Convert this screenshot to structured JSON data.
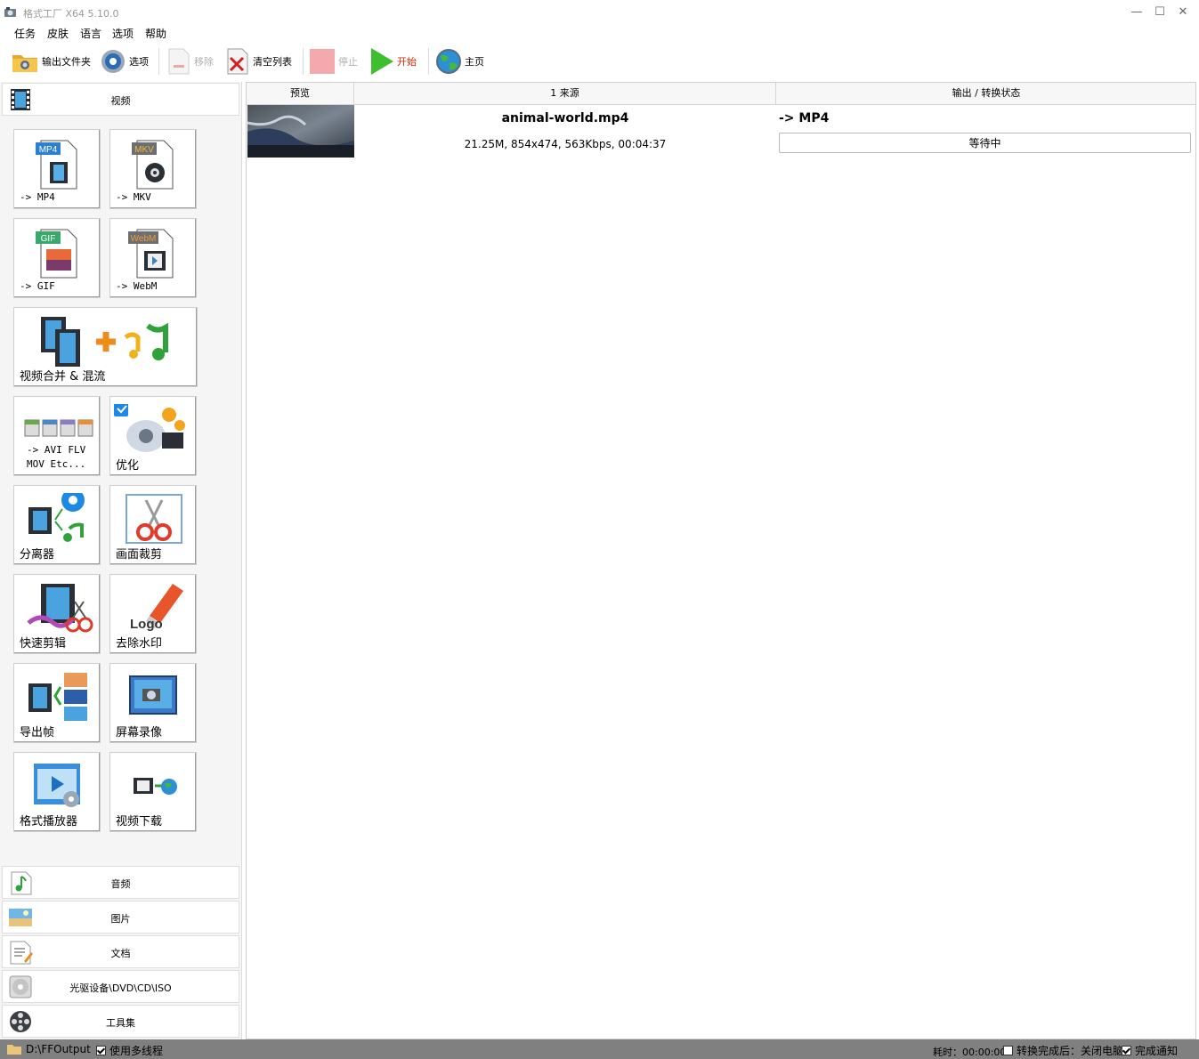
{
  "window": {
    "title": "格式工厂 X64 5.10.0",
    "minimize": "—",
    "maximize": "☐",
    "close": "✕"
  },
  "menu": [
    "任务",
    "皮肤",
    "语言",
    "选项",
    "帮助"
  ],
  "toolbar": {
    "output_folder": "输出文件夹",
    "options": "选项",
    "remove": "移除",
    "clear_list": "清空列表",
    "stop": "停止",
    "start": "开始",
    "home": "主页"
  },
  "sidebar": {
    "video": "视频",
    "audio": "音频",
    "image": "图片",
    "document": "文档",
    "disc": "光驱设备\\DVD\\CD\\ISO",
    "tools": "工具集"
  },
  "tiles": {
    "mp4": "-> MP4",
    "mkv": "-> MKV",
    "gif": "-> GIF",
    "webm": "-> WebM",
    "merge": "视频合并 & 混流",
    "avi": "-> AVI FLV\nMOV Etc...",
    "optimize": "优化",
    "splitter": "分离器",
    "crop": "画面裁剪",
    "quick_edit": "快速剪辑",
    "remove_watermark": "去除水印",
    "export_frames": "导出帧",
    "screen_record": "屏幕录像",
    "player": "格式播放器",
    "download": "视频下载"
  },
  "icon_text": {
    "mp4": "MP4",
    "mkv": "MKV",
    "gif": "GIF",
    "webm": "WebM",
    "logo": "Logo"
  },
  "table": {
    "headers": {
      "preview": "预览",
      "source": "1 来源",
      "output": "输出 / 转换状态"
    },
    "rows": [
      {
        "filename": "animal-world.mp4",
        "info": "21.25M, 854x474, 563Kbps, 00:04:37",
        "target": "-> MP4",
        "status": "等待中"
      }
    ]
  },
  "statusbar": {
    "output_path": "D:\\FFOutput",
    "multithread": "使用多线程",
    "multithread_checked": true,
    "elapsed": "耗时：00:00:00",
    "after_done": "转换完成后：关闭电脑",
    "after_done_checked": false,
    "notify": "完成通知",
    "notify_checked": true
  }
}
